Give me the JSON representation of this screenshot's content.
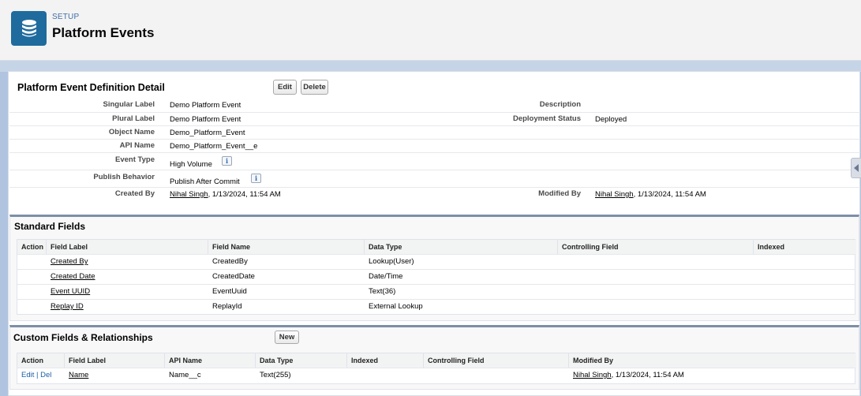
{
  "header": {
    "setup_label": "SETUP",
    "title": "Platform Events",
    "icon": "database-icon"
  },
  "detail": {
    "title": "Platform Event Definition Detail",
    "edit_label": "Edit",
    "delete_label": "Delete",
    "fields": {
      "singular_label": {
        "label": "Singular Label",
        "value": "Demo Platform Event"
      },
      "plural_label": {
        "label": "Plural Label",
        "value": "Demo Platform Event"
      },
      "object_name": {
        "label": "Object Name",
        "value": "Demo_Platform_Event"
      },
      "api_name": {
        "label": "API Name",
        "value": "Demo_Platform_Event__e"
      },
      "event_type": {
        "label": "Event Type",
        "value": "High Volume"
      },
      "publish_behavior": {
        "label": "Publish Behavior",
        "value": "Publish After Commit"
      },
      "created_by": {
        "label": "Created By",
        "user": "Nihal Singh",
        "date": ", 1/13/2024, 11:54 AM"
      },
      "description": {
        "label": "Description",
        "value": ""
      },
      "deployment_status": {
        "label": "Deployment Status",
        "value": "Deployed"
      },
      "modified_by": {
        "label": "Modified By",
        "user": "Nihal Singh",
        "date": ", 1/13/2024, 11:54 AM"
      }
    }
  },
  "standard_fields": {
    "title": "Standard Fields",
    "columns": [
      "Action",
      "Field Label",
      "Field Name",
      "Data Type",
      "Controlling Field",
      "Indexed"
    ],
    "rows": [
      {
        "label": "Created By",
        "name": "CreatedBy",
        "type": "Lookup(User)"
      },
      {
        "label": "Created Date",
        "name": "CreatedDate",
        "type": "Date/Time"
      },
      {
        "label": "Event UUID",
        "name": "EventUuid",
        "type": "Text(36)"
      },
      {
        "label": "Replay ID",
        "name": "ReplayId",
        "type": "External Lookup"
      }
    ]
  },
  "custom_fields": {
    "title": "Custom Fields & Relationships",
    "new_label": "New",
    "columns": [
      "Action",
      "Field Label",
      "API Name",
      "Data Type",
      "Indexed",
      "Controlling Field",
      "Modified By"
    ],
    "rows": [
      {
        "edit": "Edit",
        "sep": " | ",
        "del": "Del",
        "label": "Name",
        "api": "Name__c",
        "type": "Text(255)",
        "mod_user": "Nihal Singh",
        "mod_date": ", 1/13/2024, 11:54 AM"
      }
    ]
  }
}
